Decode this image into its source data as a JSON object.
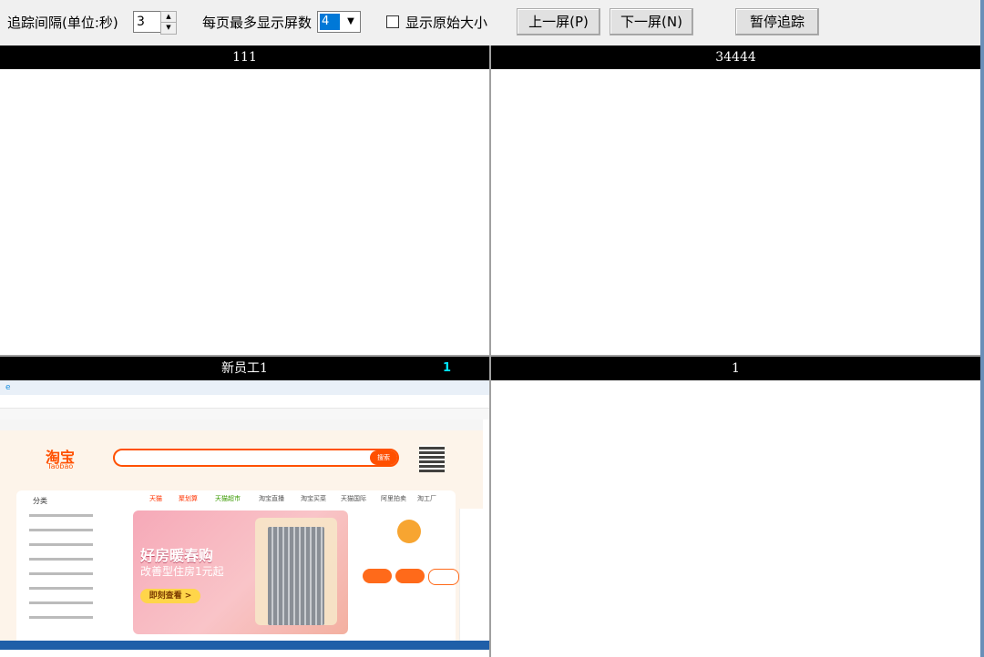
{
  "toolbar": {
    "interval_label": "追踪间隔(单位:秒)",
    "interval_value": "3",
    "max_screens_label": "每页最多显示屏数",
    "max_screens_value": "4",
    "show_original_label": "显示原始大小",
    "prev_button": "上一屏(P)",
    "next_button": "下一屏(N)",
    "pause_button": "暂停追踪"
  },
  "panels": [
    {
      "title": "111",
      "badge": ""
    },
    {
      "title": "34444",
      "badge": ""
    },
    {
      "title": "新员工1",
      "badge": "1"
    },
    {
      "title": "1",
      "badge": ""
    }
  ],
  "screenshot": {
    "logo": "淘宝",
    "logo_en": "Taobao",
    "search_button": "搜索",
    "category_title": "分类",
    "banner_headline": "好房暖春购",
    "banner_subline": "改善型住房1元起",
    "banner_cta": "即刻查看 >",
    "nav_tabs": [
      "天猫",
      "聚划算",
      "天猫超市",
      "淘宝直播",
      "淘宝买菜",
      "天猫国际",
      "阿里拍卖",
      "淘工厂"
    ],
    "accent_color": "#ff5000"
  }
}
